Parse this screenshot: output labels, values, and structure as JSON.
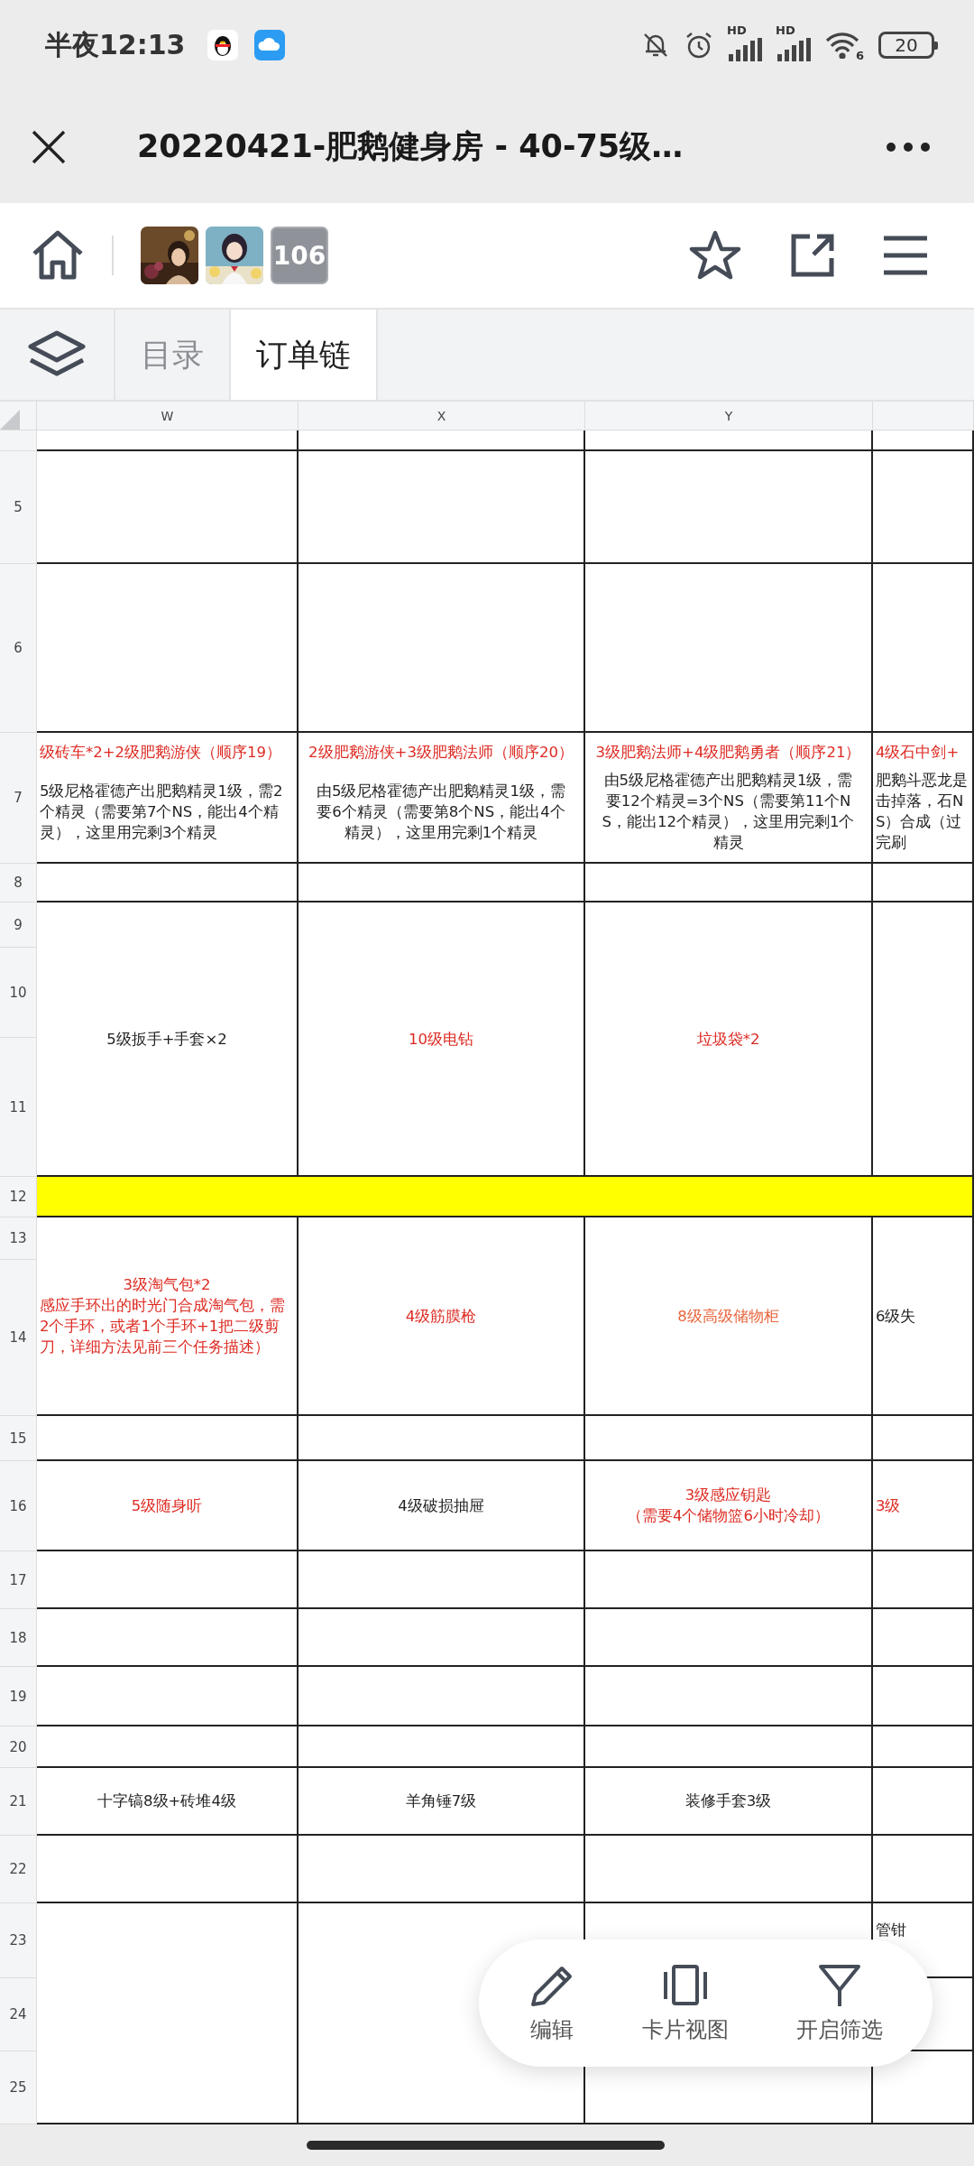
{
  "status_bar": {
    "time": "半夜12:13",
    "network_labels": [
      "HD",
      "HD"
    ],
    "wifi_label": "6",
    "battery": "20"
  },
  "header": {
    "title": "20220421-肥鹅健身房 - 40-75级…"
  },
  "toolbar": {
    "avatars": [
      {
        "kind": "picture"
      },
      {
        "kind": "picture"
      },
      {
        "kind": "count",
        "text": "106"
      }
    ]
  },
  "sheet_tabs": [
    {
      "label": "目录",
      "selected": false
    },
    {
      "label": "订单链",
      "selected": true
    }
  ],
  "columns": [
    "W",
    "X",
    "Y"
  ],
  "rows": [
    {
      "number": "5",
      "highlighted": false
    },
    {
      "number": "6",
      "highlighted": false
    },
    {
      "number": "7",
      "highlighted": false
    },
    {
      "number": "8",
      "highlighted": false
    },
    {
      "number": "9",
      "highlighted": false
    },
    {
      "number": "10",
      "highlighted": false
    },
    {
      "number": "11",
      "highlighted": false
    },
    {
      "number": "12",
      "highlighted": true
    },
    {
      "number": "13",
      "highlighted": false
    },
    {
      "number": "14",
      "highlighted": false
    },
    {
      "number": "15",
      "highlighted": false
    },
    {
      "number": "16",
      "highlighted": false
    },
    {
      "number": "17",
      "highlighted": false
    },
    {
      "number": "18",
      "highlighted": false
    },
    {
      "number": "19",
      "highlighted": false
    },
    {
      "number": "20",
      "highlighted": false
    },
    {
      "number": "21",
      "highlighted": false
    },
    {
      "number": "22",
      "highlighted": false
    },
    {
      "number": "23",
      "highlighted": false
    },
    {
      "number": "24",
      "highlighted": false
    },
    {
      "number": "25",
      "highlighted": false
    }
  ],
  "cells": [
    {
      "parts": [
        {
          "text": "级砖车*2+2级肥鹅游侠（顺序19）",
          "color": "#dd2a22"
        },
        {
          "text": "5级尼格霍德产出肥鹅精灵1级，需2个精灵（需要第7个NS，能出4个精灵），这里用完剩3个精灵",
          "color": "#1f1f1f"
        }
      ]
    },
    {
      "parts": [
        {
          "text": "2级肥鹅游侠+3级肥鹅法师（顺序20）",
          "color": "#dd2a22"
        },
        {
          "text": "由5级尼格霍德产出肥鹅精灵1级，需要6个精灵（需要第8个NS，能出4个精灵），这里用完剩1个精灵",
          "color": "#1f1f1f"
        }
      ]
    },
    {
      "parts": [
        {
          "text": "3级肥鹅法师+4级肥鹅勇者（顺序21）",
          "color": "#dd2a22"
        },
        {
          "text": "由5级尼格霍德产出肥鹅精灵1级，需要12个精灵=3个NS（需要第11个NS，能出12个精灵），这里用完剩1个精灵",
          "color": "#1f1f1f"
        }
      ]
    },
    {
      "parts": [
        {
          "text": "4级石中剑+",
          "color": "#dd2a22"
        },
        {
          "text": "肥鹅斗恶龙是击掉落，石NS）合成（过完刷",
          "color": "#1f1f1f"
        }
      ]
    },
    {
      "parts": [
        {
          "text": "5级扳手+手套×2",
          "color": "#1f1f1f"
        }
      ]
    },
    {
      "parts": [
        {
          "text": "10级电钻",
          "color": "#dd2a22"
        }
      ]
    },
    {
      "parts": [
        {
          "text": "垃圾袋*2",
          "color": "#dd2a22"
        }
      ]
    },
    {
      "parts": [
        {
          "text": "3级淘气包*2",
          "color": "#dd2a22"
        },
        {
          "text": "感应手环出的时光门合成淘气包，需2个手环，或者1个手环+1把二级剪刀，详细方法见前三个任务描述）",
          "color": "#dd2a22"
        }
      ]
    },
    {
      "parts": [
        {
          "text": "4级筋膜枪",
          "color": "#dd2a22"
        }
      ]
    },
    {
      "parts": [
        {
          "text": "8级高级储物柜",
          "color": "#e8643c"
        }
      ]
    },
    {
      "parts": [
        {
          "text": "6级失",
          "color": "#1f1f1f"
        }
      ]
    },
    {
      "parts": [
        {
          "text": "5级随身听",
          "color": "#dd2a22"
        }
      ]
    },
    {
      "parts": [
        {
          "text": "4级破损抽屉",
          "color": "#1f1f1f"
        }
      ]
    },
    {
      "parts": [
        {
          "text": "3级感应钥匙",
          "color": "#dd2a22"
        },
        {
          "text": "（需要4个储物篮6小时冷却）",
          "color": "#dd2a22"
        }
      ]
    },
    {
      "parts": [
        {
          "text": "3级",
          "color": "#dd2a22"
        }
      ]
    },
    {
      "parts": [
        {
          "text": "十字镐8级+砖堆4级",
          "color": "#1f1f1f"
        }
      ]
    },
    {
      "parts": [
        {
          "text": "羊角锤7级",
          "color": "#1f1f1f"
        }
      ]
    },
    {
      "parts": [
        {
          "text": "装修手套3级",
          "color": "#1f1f1f"
        }
      ]
    },
    {
      "parts": [
        {
          "text": "管钳",
          "color": "#1f1f1f"
        }
      ]
    }
  ],
  "actions": [
    {
      "kind": "edit",
      "label": "编辑"
    },
    {
      "kind": "cards",
      "label": "卡片视图"
    },
    {
      "kind": "filter",
      "label": "开启筛选"
    }
  ]
}
